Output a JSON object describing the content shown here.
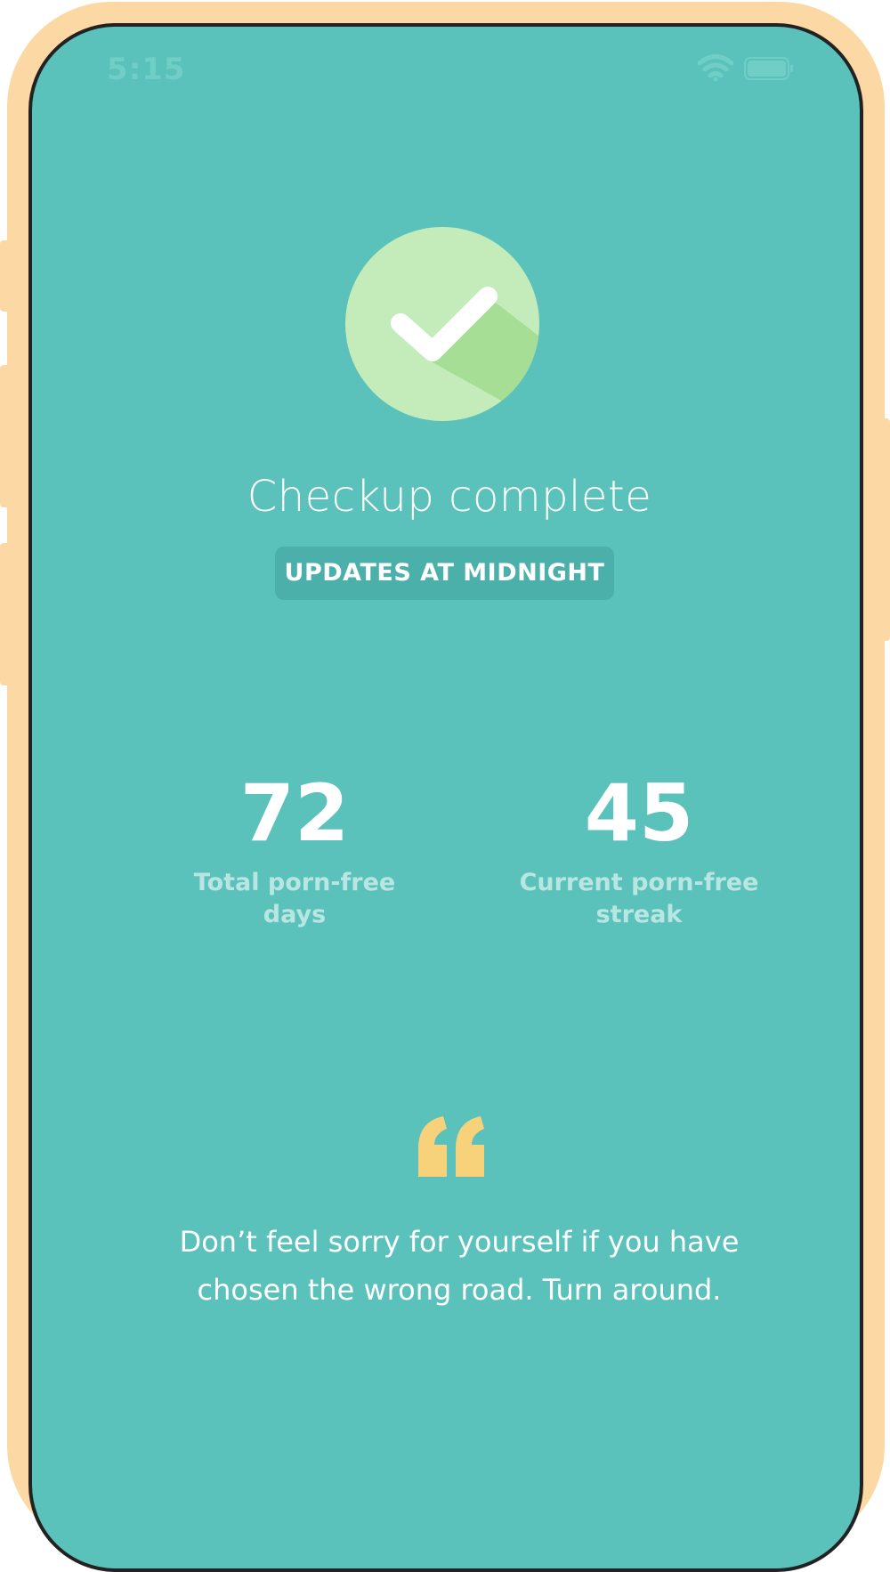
{
  "status_bar": {
    "time": "5:15",
    "wifi_icon": "wifi-icon",
    "battery_icon": "battery-icon"
  },
  "header": {
    "icon": "checkmark-circle-icon",
    "title": "Checkup complete",
    "badge": "UPDATES AT MIDNIGHT"
  },
  "stats": [
    {
      "value": "72",
      "label_line1": "Total porn-free",
      "label_line2": "days"
    },
    {
      "value": "45",
      "label_line1": "Current porn-free",
      "label_line2": "streak"
    }
  ],
  "quote": {
    "icon": "quote-mark-icon",
    "line1": "Don’t feel sorry for yourself if you have",
    "line2": "chosen the wrong road. Turn around."
  },
  "colors": {
    "background": "#5bc2bb",
    "frame": "#fcd9a4",
    "badge": "#4bb0aa",
    "check_circle": "#c3ecba",
    "check_shadow": "#a5de94",
    "quote_mark": "#f8d27a"
  }
}
